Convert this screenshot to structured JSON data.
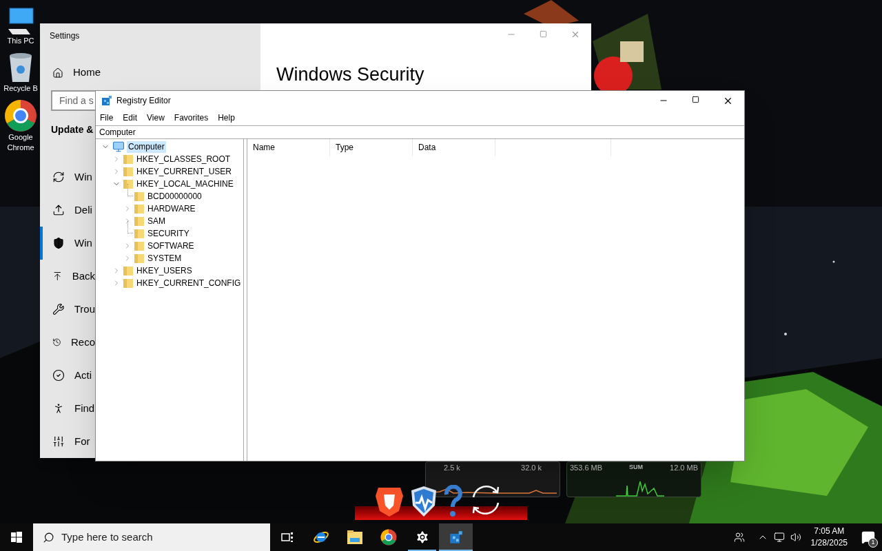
{
  "desktop_icons": [
    {
      "kind": "pc",
      "label": "This PC"
    },
    {
      "kind": "bin",
      "label": "Recycle B"
    },
    {
      "kind": "chrome",
      "label": "Google Chrome"
    }
  ],
  "widgets": {
    "left": {
      "value_1": "2.5 k",
      "value_2": "32.0 k"
    },
    "right": {
      "value_1": "353.6 MB",
      "label": "SUM",
      "value_2": "12.0 MB"
    }
  },
  "dock": [
    {
      "kind": "lion"
    },
    {
      "kind": "shield"
    },
    {
      "kind": "help"
    },
    {
      "kind": "sync"
    }
  ],
  "settings": {
    "title": "Settings",
    "home": "Home",
    "search": {
      "placeholder": "Find a s"
    },
    "section": "Update &",
    "heading": "Windows Security",
    "nav": [
      {
        "kind": "sync",
        "label": "Win",
        "selected": false
      },
      {
        "kind": "delivery",
        "label": "Deli",
        "selected": false
      },
      {
        "kind": "shield",
        "label": "Win",
        "selected": true
      },
      {
        "kind": "backup",
        "label": "Back",
        "selected": false
      },
      {
        "kind": "wrench",
        "label": "Trou",
        "selected": false
      },
      {
        "kind": "recovery",
        "label": "Reco",
        "selected": false
      },
      {
        "kind": "check",
        "label": "Acti",
        "selected": false
      },
      {
        "kind": "find",
        "label": "Find",
        "selected": false
      },
      {
        "kind": "dev",
        "label": "For",
        "selected": false
      }
    ]
  },
  "registry": {
    "title": "Registry Editor",
    "menu": [
      "File",
      "Edit",
      "View",
      "Favorites",
      "Help"
    ],
    "address": "Computer",
    "tree": [
      {
        "label": "Computer",
        "kind": "computer",
        "expanded": true,
        "selected": true,
        "children": [
          {
            "label": "HKEY_CLASSES_ROOT",
            "kind": "branch",
            "expanded": false,
            "selected": false
          },
          {
            "label": "HKEY_CURRENT_USER",
            "kind": "branch",
            "expanded": false,
            "selected": false
          },
          {
            "label": "HKEY_LOCAL_MACHINE",
            "kind": "branch",
            "expanded": true,
            "selected": false,
            "children": [
              {
                "label": "BCD00000000",
                "kind": "leaf",
                "expanded": false,
                "selected": false
              },
              {
                "label": "HARDWARE",
                "kind": "branch",
                "expanded": false,
                "selected": false
              },
              {
                "label": "SAM",
                "kind": "branch",
                "expanded": false,
                "selected": false
              },
              {
                "label": "SECURITY",
                "kind": "leaf",
                "expanded": false,
                "selected": false
              },
              {
                "label": "SOFTWARE",
                "kind": "branch",
                "expanded": false,
                "selected": false
              },
              {
                "label": "SYSTEM",
                "kind": "branch",
                "expanded": false,
                "selected": false
              }
            ]
          },
          {
            "label": "HKEY_USERS",
            "kind": "branch",
            "expanded": false,
            "selected": false
          },
          {
            "label": "HKEY_CURRENT_CONFIG",
            "kind": "branch",
            "expanded": false,
            "selected": false
          }
        ]
      }
    ],
    "columns": [
      "Name",
      "Type",
      "Data"
    ]
  },
  "taskbar": {
    "search": {
      "placeholder": "Type here to search"
    },
    "apps": [
      {
        "kind": "taskview",
        "running": false,
        "active": false
      },
      {
        "kind": "ie",
        "running": false,
        "active": false
      },
      {
        "kind": "explorer",
        "running": false,
        "active": false
      },
      {
        "kind": "chrome",
        "running": false,
        "active": false
      },
      {
        "kind": "settings",
        "running": true,
        "active": false
      },
      {
        "kind": "regedit",
        "running": true,
        "active": true
      }
    ],
    "time": "7:05 AM",
    "date": "1/28/2025",
    "notifications": "1"
  }
}
